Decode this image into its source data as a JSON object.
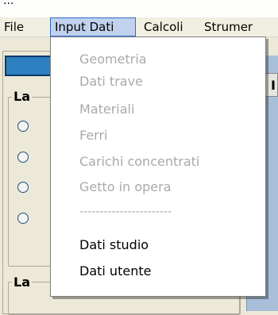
{
  "window": {
    "title": "..."
  },
  "menubar": {
    "items": [
      {
        "label": "File"
      },
      {
        "label": "Input Dati"
      },
      {
        "label": "Calcoli"
      },
      {
        "label": "Strumer"
      }
    ]
  },
  "dropdown": {
    "items": [
      {
        "label": "Geometria",
        "enabled": false
      },
      {
        "label": "Dati trave",
        "enabled": false
      },
      {
        "label": "Materiali",
        "enabled": false
      },
      {
        "label": "Ferri",
        "enabled": false
      },
      {
        "label": "Carichi concentrati",
        "enabled": false
      },
      {
        "label": "Getto in opera",
        "enabled": false
      },
      {
        "label": "-----------------------",
        "enabled": false
      },
      {
        "label": "Dati studio",
        "enabled": true
      },
      {
        "label": "Dati utente",
        "enabled": true
      }
    ]
  },
  "background": {
    "group1_legend": "La",
    "group2_legend": "La",
    "right_header": "I",
    "radio_count": 4
  },
  "colors": {
    "menu_highlight": "#c1d2ee",
    "blue_button": "#2e7fc0",
    "disabled_text": "#a9a9a9"
  }
}
